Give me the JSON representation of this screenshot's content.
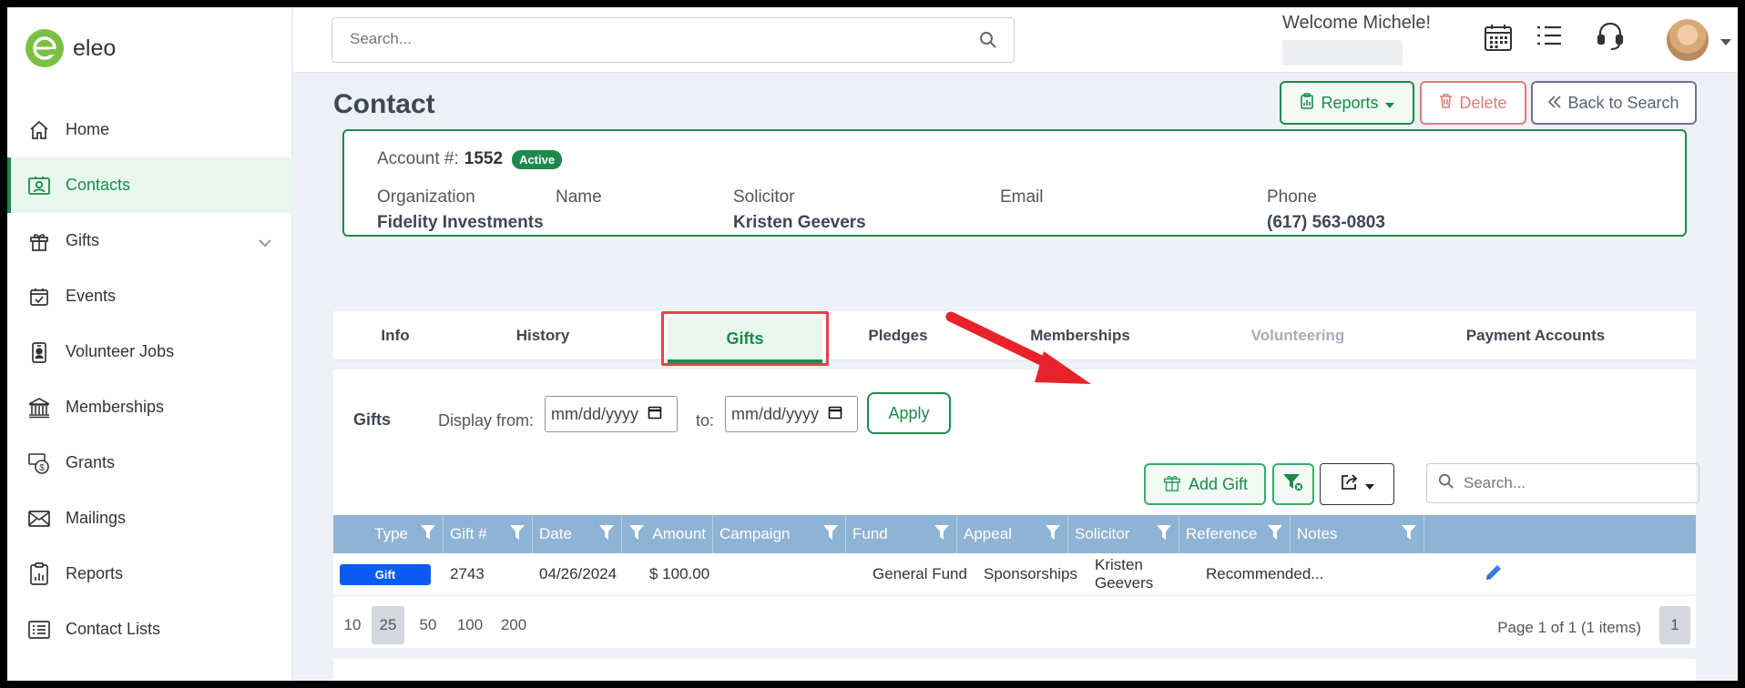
{
  "app": {
    "name": "eleo",
    "brand_color": "#1c8a4c",
    "logo_color": "#7ac043"
  },
  "topbar": {
    "search_placeholder": "Search...",
    "welcome": "Welcome Michele!",
    "icons": [
      "calendar-icon",
      "list-icon",
      "headset-icon",
      "avatar",
      "caret-down-icon"
    ]
  },
  "sidebar": {
    "items": [
      {
        "label": "Home",
        "icon": "home-icon"
      },
      {
        "label": "Contacts",
        "icon": "contact-card-icon",
        "active": true
      },
      {
        "label": "Gifts",
        "icon": "gift-icon",
        "expandable": true
      },
      {
        "label": "Events",
        "icon": "calendar-check-icon"
      },
      {
        "label": "Volunteer Jobs",
        "icon": "badge-icon"
      },
      {
        "label": "Memberships",
        "icon": "bank-icon"
      },
      {
        "label": "Grants",
        "icon": "money-icon"
      },
      {
        "label": "Mailings",
        "icon": "envelope-icon"
      },
      {
        "label": "Reports",
        "icon": "report-icon"
      },
      {
        "label": "Contact Lists",
        "icon": "list-box-icon"
      }
    ]
  },
  "page": {
    "title": "Contact",
    "buttons": {
      "reports": "Reports",
      "delete": "Delete",
      "back": "Back to Search"
    }
  },
  "account": {
    "label": "Account #:",
    "number": "1552",
    "status": "Active",
    "fields": {
      "organization": {
        "label": "Organization",
        "value": "Fidelity Investments"
      },
      "name": {
        "label": "Name",
        "value": ""
      },
      "solicitor": {
        "label": "Solicitor",
        "value": "Kristen Geevers"
      },
      "email": {
        "label": "Email",
        "value": ""
      },
      "phone": {
        "label": "Phone",
        "value": "(617) 563-0803"
      }
    }
  },
  "tabs": {
    "info": "Info",
    "history": "History",
    "gifts": "Gifts",
    "pledges": "Pledges",
    "memberships": "Memberships",
    "volunteering": "Volunteering",
    "payment_accounts": "Payment Accounts"
  },
  "gifts_panel": {
    "title": "Gifts",
    "display_from": "Display from:",
    "to": "to:",
    "date_placeholder_from": "mm/dd/yyyy",
    "date_placeholder_to": "mm/dd/yyyy",
    "apply": "Apply",
    "add_gift": "Add Gift",
    "search_placeholder": "Search...",
    "columns": {
      "type": "Type",
      "gift_no": "Gift #",
      "date": "Date",
      "amount": "Amount",
      "campaign": "Campaign",
      "fund": "Fund",
      "appeal": "Appeal",
      "solicitor": "Solicitor",
      "reference": "Reference",
      "notes": "Notes"
    },
    "row": {
      "type": "Gift",
      "gift_no": "2743",
      "date": "04/26/2024",
      "amount": "$ 100.00",
      "campaign": "",
      "fund": "General Fund",
      "appeal": "Sponsorships",
      "solicitor": "Kristen Geevers",
      "reference": "Recommended...",
      "notes": ""
    },
    "pager": {
      "sizes": [
        "10",
        "25",
        "50",
        "100",
        "200"
      ],
      "info": "Page 1 of 1 (1 items)",
      "current": "1"
    }
  }
}
